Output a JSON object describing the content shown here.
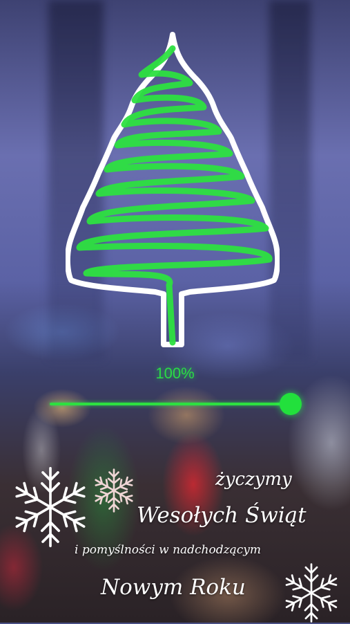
{
  "progress": {
    "percent_label": "100%",
    "value": 1.0
  },
  "greeting": {
    "line1": "życzymy",
    "line2": "Wesołych Świąt",
    "line3": "i pomyślności w nadchodzącym",
    "line4": "Nowym Roku"
  },
  "colors": {
    "neon_green": "#2de040",
    "outline": "#ffffff"
  },
  "icons": {
    "tree": "neon-christmas-tree-icon",
    "snowflakes": [
      "snowflake-icon",
      "snowflake-icon",
      "snowflake-icon"
    ]
  }
}
